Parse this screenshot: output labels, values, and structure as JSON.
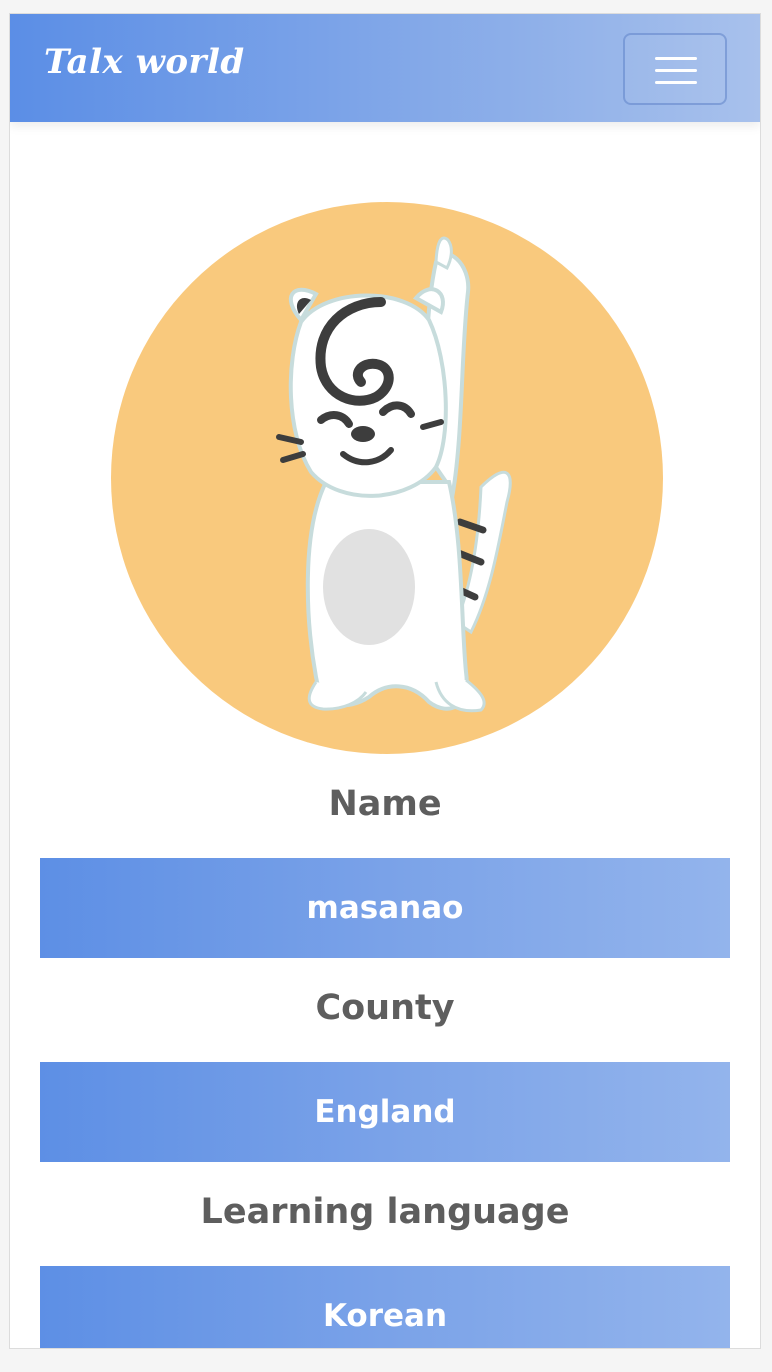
{
  "navbar": {
    "brand": "Talx world",
    "menu_icon": "hamburger-icon"
  },
  "profile": {
    "avatar_icon": "tiger-mascot-illustration",
    "avatar_bg": "#f9c97d",
    "fields": [
      {
        "label": "Name",
        "value": "masanao"
      },
      {
        "label": "County",
        "value": "England"
      },
      {
        "label": "Learning language",
        "value": "Korean"
      }
    ]
  },
  "colors": {
    "gradient_start": "#5b8ee6",
    "gradient_end": "#a8c1ec",
    "label_text": "#5e5e5e"
  }
}
